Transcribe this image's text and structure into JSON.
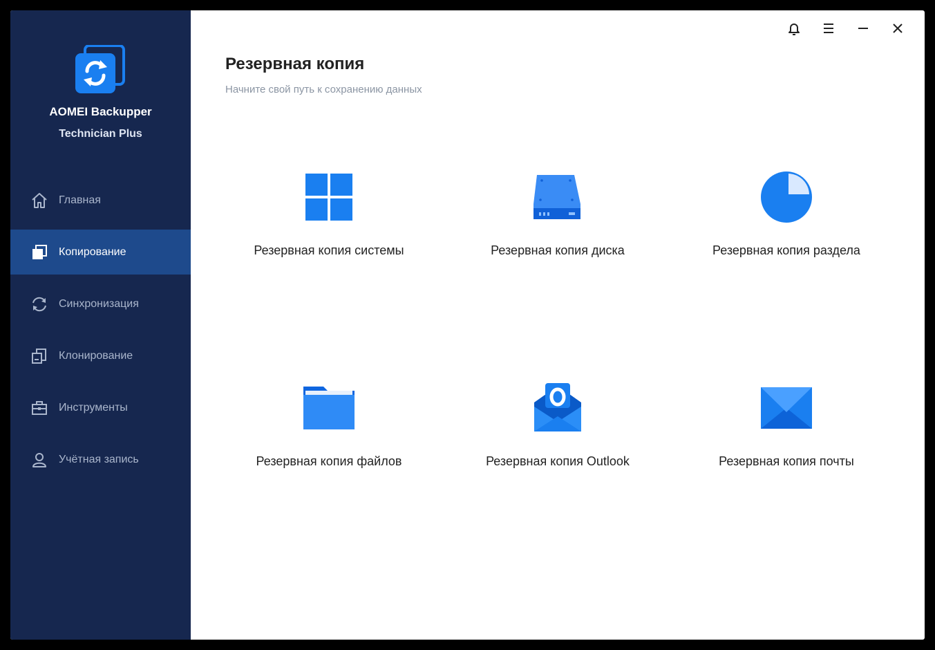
{
  "app": {
    "name_line1": "AOMEI Backupper",
    "name_line2": "Technician Plus"
  },
  "sidebar": {
    "items": [
      {
        "label": "Главная",
        "icon": "home-icon",
        "active": false
      },
      {
        "label": "Копирование",
        "icon": "backup-icon",
        "active": true
      },
      {
        "label": "Синхронизация",
        "icon": "sync-icon",
        "active": false
      },
      {
        "label": "Клонирование",
        "icon": "clone-icon",
        "active": false
      },
      {
        "label": "Инструменты",
        "icon": "toolbox-icon",
        "active": false
      },
      {
        "label": "Учётная запись",
        "icon": "user-icon",
        "active": false
      }
    ]
  },
  "main": {
    "title": "Резервная копия",
    "subtitle": "Начните свой путь к сохранению данных",
    "tiles": [
      {
        "label": "Резервная копия системы",
        "icon": "windows-icon"
      },
      {
        "label": "Резервная копия диска",
        "icon": "hard-disk-icon"
      },
      {
        "label": "Резервная копия раздела",
        "icon": "partition-pie-icon"
      },
      {
        "label": "Резервная копия файлов",
        "icon": "folder-icon"
      },
      {
        "label": "Резервная копия Outlook",
        "icon": "outlook-icon"
      },
      {
        "label": "Резервная копия почты",
        "icon": "envelope-icon"
      }
    ]
  },
  "colors": {
    "sidebar_bg": "#16274f",
    "active_item": "#1e4a8c",
    "accent": "#1a7ff0"
  }
}
